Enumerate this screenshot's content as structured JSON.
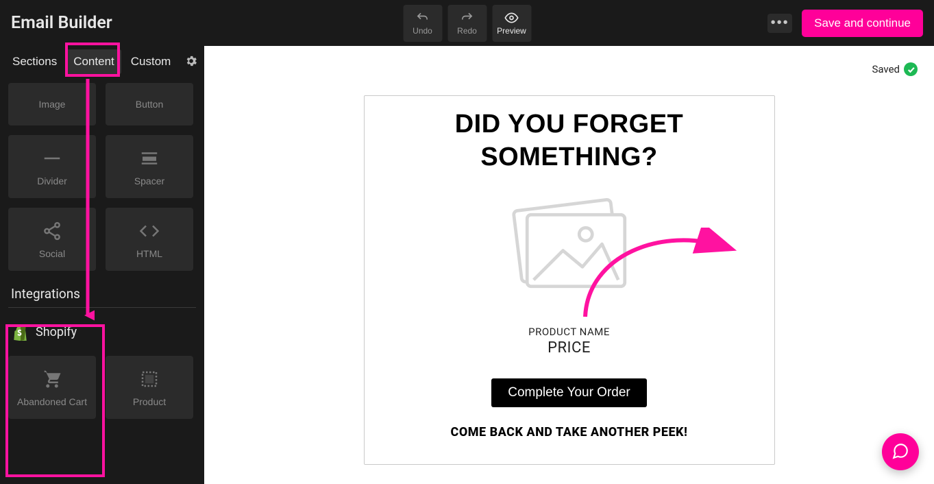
{
  "header": {
    "title": "Email Builder",
    "undo": "Undo",
    "redo": "Redo",
    "preview": "Preview",
    "save": "Save and continue"
  },
  "tabs": {
    "sections": "Sections",
    "content": "Content",
    "custom": "Custom"
  },
  "blocks": {
    "image": "Image",
    "button": "Button",
    "divider": "Divider",
    "spacer": "Spacer",
    "social": "Social",
    "html": "HTML"
  },
  "integrations": {
    "title": "Integrations",
    "shopify": "Shopify",
    "abandoned_cart": "Abandoned Cart",
    "product": "Product"
  },
  "canvas": {
    "saved": "Saved",
    "title_line1": "DID YOU FORGET",
    "title_line2": "SOMETHING?",
    "product_name": "PRODUCT NAME",
    "price": "PRICE",
    "cta": "Complete Your Order",
    "subheading": "COME BACK AND TAKE ANOTHER PEEK!"
  },
  "colors": {
    "accent": "#ff0099",
    "success": "#1db954"
  }
}
